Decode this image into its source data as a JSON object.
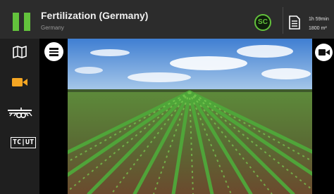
{
  "header": {
    "title": "Fertilization (Germany)",
    "subtitle": "Germany",
    "badge": "SC",
    "duration": "1h 59min",
    "area": "1800 m²",
    "accent_color": "#63c23c"
  },
  "sidebar": {
    "items": [
      {
        "icon": "map-icon"
      },
      {
        "icon": "camera-icon",
        "active": true,
        "color": "#f5a623"
      },
      {
        "icon": "implement-icon"
      },
      {
        "icon": "tc-ut-icon",
        "label": "TC|UT"
      }
    ]
  },
  "main": {
    "menu_icon": "menu-icon",
    "camera_icon": "camera-switch-icon",
    "view": "camera-feed"
  }
}
